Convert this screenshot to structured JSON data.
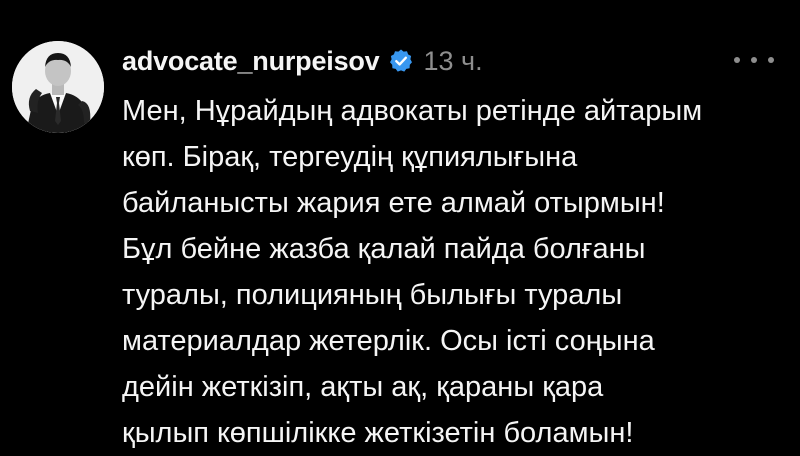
{
  "post": {
    "author": {
      "username": "advocate_nurpeisov",
      "verified": true,
      "avatar_icon": "profile-photo"
    },
    "timestamp": "13 ч.",
    "more_icon": "more-options-icon",
    "caption_lines": [
      "Мен, Нұрайдың адвокаты ретінде айтарым",
      "көп. Бірақ, тергеудің құпиялығына",
      "байланысты жария ете алмай отырмын!",
      "Бұл бейне жазба қалай пайда болғаны",
      "туралы, полицияның былығы туралы",
      "материалдар жетерлік. Осы істі соңына",
      "дейін жеткізіп, ақты ақ, қараны қара",
      "қылып көпшілікке жеткізетін боламын!"
    ]
  },
  "colors": {
    "background": "#000000",
    "text": "#f5f5f5",
    "muted": "#8e8e8e",
    "verified_badge": "#3897f0"
  }
}
